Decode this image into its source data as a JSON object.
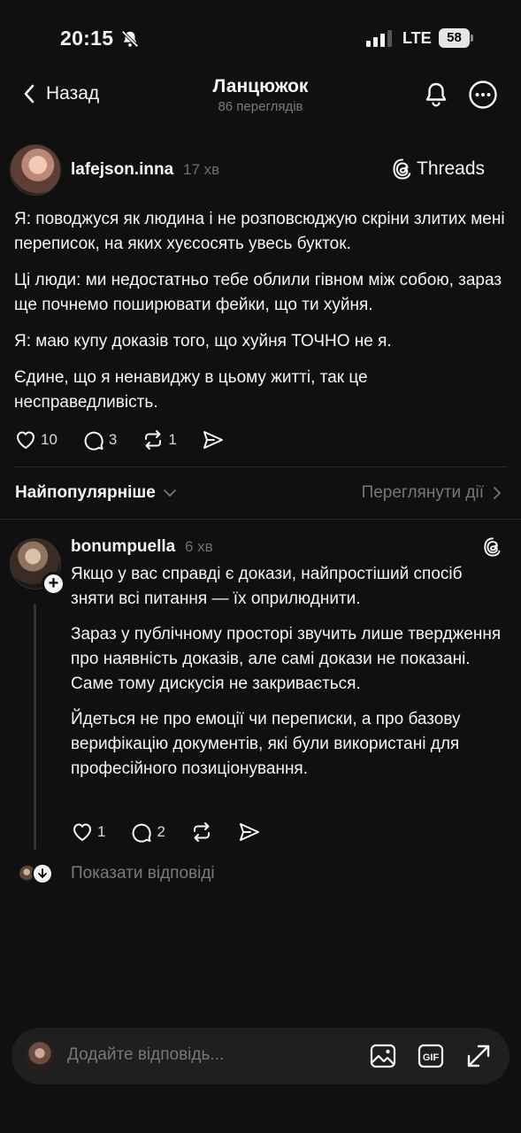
{
  "status_bar": {
    "time": "20:15",
    "network": "LTE",
    "battery": "58"
  },
  "nav": {
    "back_label": "Назад",
    "title": "Ланцюжок",
    "views": "86 переглядів"
  },
  "post": {
    "username": "lafejson.inna",
    "time": "17 хв",
    "threads_label": "Threads",
    "paragraphs": [
      "Я: поводжуся як людина і не розповсюджую скріни злитих мені переписок, на яких хуєсосять увесь букток.",
      "Ці люди: ми недостатньо тебе облили гівном між собою, зараз ще почнемо поширювати фейки, що ти хуйня.",
      "Я: маю купу доказів того, що хуйня ТОЧНО не я.",
      "Єдине, що я ненавиджу в цьому житті, так це несправедливість."
    ],
    "likes": "10",
    "comments": "3",
    "reposts": "1"
  },
  "sort": {
    "label": "Найпопулярніше",
    "view_activity": "Переглянути дії"
  },
  "reply": {
    "username": "bonumpuella",
    "time": "6 хв",
    "paragraphs": [
      "Якщо у вас справді є докази, найпростіший спосіб зняти всі питання — їх оприлюднити.",
      "Зараз у публічному просторі звучить лише твердження про наявність доказів, але самі докази не показані. Саме тому дискусія не закривається.",
      "Йдеться не про емоції чи переписки, а про базову верифікацію документів, які були використані для професійного позиціонування."
    ],
    "likes": "1",
    "comments": "2",
    "show_replies": "Показати відповіді"
  },
  "composer": {
    "placeholder": "Додайте відповідь..."
  },
  "icons": {
    "bell": "bell-icon",
    "more": "more-icon",
    "threads": "threads-icon",
    "like": "heart-icon",
    "comment": "comment-icon",
    "repost": "repost-icon",
    "share": "send-icon",
    "image": "image-icon",
    "gif": "gif-icon",
    "expand": "expand-icon"
  }
}
